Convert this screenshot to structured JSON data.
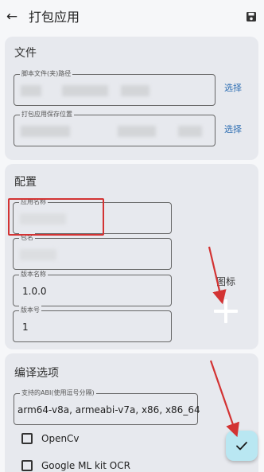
{
  "header": {
    "title": "打包应用"
  },
  "files_section": {
    "title": "文件",
    "script_path_label": "脚本文件(夹)路径",
    "script_path_select": "选择",
    "output_path_label": "打包应用保存位置",
    "output_path_select": "选择"
  },
  "config_section": {
    "title": "配置",
    "app_name_label": "应用名称",
    "package_label": "包名",
    "version_name_label": "版本名称",
    "version_name_value": "1.0.0",
    "version_code_label": "版本号",
    "version_code_value": "1",
    "icon_label": "图标"
  },
  "compile_section": {
    "title": "编译选项",
    "abi_label": "支持的ABI(使用逗号分隔)",
    "abi_value": "arm64-v8a, armeabi-v7a, x86, x86_64",
    "option_opencv": "OpenCv",
    "option_mlkit": "Google ML kit OCR"
  },
  "colors": {
    "accent": "#2f6fb3",
    "annotation": "#d33333",
    "fab_bg": "#b9e7f2",
    "card_bg": "#e7e9ee"
  }
}
